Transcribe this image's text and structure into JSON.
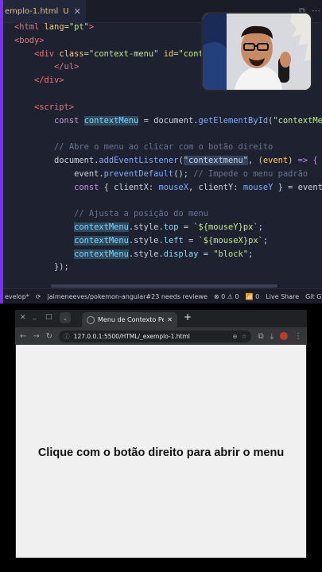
{
  "editor": {
    "tab": {
      "filename": "emplo-1.html",
      "modified_flag": "U",
      "close": "✕"
    },
    "lines": [
      [
        {
          "t": "<html ",
          "c": "tag"
        },
        {
          "t": "lang",
          "c": "attr"
        },
        {
          "t": "=\"pt\"",
          "c": "str"
        },
        {
          "t": ">",
          "c": "tag"
        }
      ],
      [
        {
          "t": "<body>",
          "c": "tag"
        }
      ],
      [
        {
          "t": "    <div ",
          "c": "tag"
        },
        {
          "t": "class",
          "c": "attr"
        },
        {
          "t": "=\"context-menu\" ",
          "c": "str"
        },
        {
          "t": "id",
          "c": "attr"
        },
        {
          "t": "=\"context",
          "c": "str"
        }
      ],
      [
        {
          "t": "        </ul>",
          "c": "tag"
        }
      ],
      [
        {
          "t": "    </div>",
          "c": "tag"
        }
      ],
      [
        {
          "t": "",
          "c": "plain"
        }
      ],
      [
        {
          "t": "    <script>",
          "c": "tag"
        }
      ],
      [
        {
          "t": "        ",
          "c": "plain"
        },
        {
          "t": "const ",
          "c": "kw"
        },
        {
          "t": "contextMenu",
          "c": "hl"
        },
        {
          "t": " = document.",
          "c": "plain"
        },
        {
          "t": "getElementById",
          "c": "fn"
        },
        {
          "t": "(",
          "c": "plain"
        },
        {
          "t": "\"contextMenu\"",
          "c": "str"
        },
        {
          "t": ");",
          "c": "plain"
        }
      ],
      [
        {
          "t": "",
          "c": "plain"
        }
      ],
      [
        {
          "t": "        // Abre o menu ao clicar com o botão direito",
          "c": "cm"
        }
      ],
      [
        {
          "t": "        document.",
          "c": "plain"
        },
        {
          "t": "addEventListener",
          "c": "fn"
        },
        {
          "t": "(",
          "c": "plain"
        },
        {
          "t": "\"contextmenu\"",
          "c": "sel"
        },
        {
          "t": ", ",
          "c": "plain"
        },
        {
          "t": "(event) ",
          "c": "attr"
        },
        {
          "t": "=> {",
          "c": "kw"
        }
      ],
      [
        {
          "t": "            event.",
          "c": "plain"
        },
        {
          "t": "preventDefault",
          "c": "fn"
        },
        {
          "t": "(); ",
          "c": "plain"
        },
        {
          "t": "// Impede o menu padrão",
          "c": "cm"
        }
      ],
      [
        {
          "t": "            ",
          "c": "plain"
        },
        {
          "t": "const ",
          "c": "kw"
        },
        {
          "t": "{ clientX: ",
          "c": "plain"
        },
        {
          "t": "mouseX",
          "c": "var"
        },
        {
          "t": ", clientY: ",
          "c": "plain"
        },
        {
          "t": "mouseY",
          "c": "var"
        },
        {
          "t": " } = event;",
          "c": "plain"
        }
      ],
      [
        {
          "t": "",
          "c": "plain"
        }
      ],
      [
        {
          "t": "            // Ajusta a posição do menu",
          "c": "cm"
        }
      ],
      [
        {
          "t": "            ",
          "c": "plain"
        },
        {
          "t": "contextMenu",
          "c": "hl"
        },
        {
          "t": ".style.",
          "c": "plain"
        },
        {
          "t": "top",
          "c": "prop"
        },
        {
          "t": " = ",
          "c": "plain"
        },
        {
          "t": "`${mouseY}px`",
          "c": "str"
        },
        {
          "t": ";",
          "c": "plain"
        }
      ],
      [
        {
          "t": "            ",
          "c": "plain"
        },
        {
          "t": "contextMenu",
          "c": "hl"
        },
        {
          "t": ".style.",
          "c": "plain"
        },
        {
          "t": "left",
          "c": "prop"
        },
        {
          "t": " = ",
          "c": "plain"
        },
        {
          "t": "`${mouseX}px`",
          "c": "str"
        },
        {
          "t": ";",
          "c": "plain"
        }
      ],
      [
        {
          "t": "            ",
          "c": "plain"
        },
        {
          "t": "contextMenu",
          "c": "hl"
        },
        {
          "t": ".style.",
          "c": "plain"
        },
        {
          "t": "display",
          "c": "prop"
        },
        {
          "t": " = ",
          "c": "plain"
        },
        {
          "t": "\"block\"",
          "c": "str"
        },
        {
          "t": ";",
          "c": "plain"
        }
      ],
      [
        {
          "t": "        });",
          "c": "plain"
        }
      ],
      [
        {
          "t": "",
          "c": "plain"
        }
      ],
      [
        {
          "t": "        // ...",
          "c": "cm"
        }
      ]
    ],
    "status": {
      "branch_prefix": "evelop*",
      "sync": "⟳",
      "pr": "jaimeneeves/pokemon-angular#23 needs reviewe",
      "errors": "⊗ 0 ⚠ 0",
      "wifi": "📶 0",
      "live_share": "Live Share",
      "git_graph": "Git Graph"
    }
  },
  "browser": {
    "tab_title": "Menu de Contexto Perso",
    "tab_close": "✕",
    "new_tab": "+",
    "url": "127.0.0.1:5500/HTML/_exemplo-1.html",
    "heading": "Clique com o botão direito para abrir o menu"
  },
  "colors": {
    "accent": "#7b2cff",
    "editor_bg": "#1e2230",
    "page_bg": "#f0f0f0"
  }
}
